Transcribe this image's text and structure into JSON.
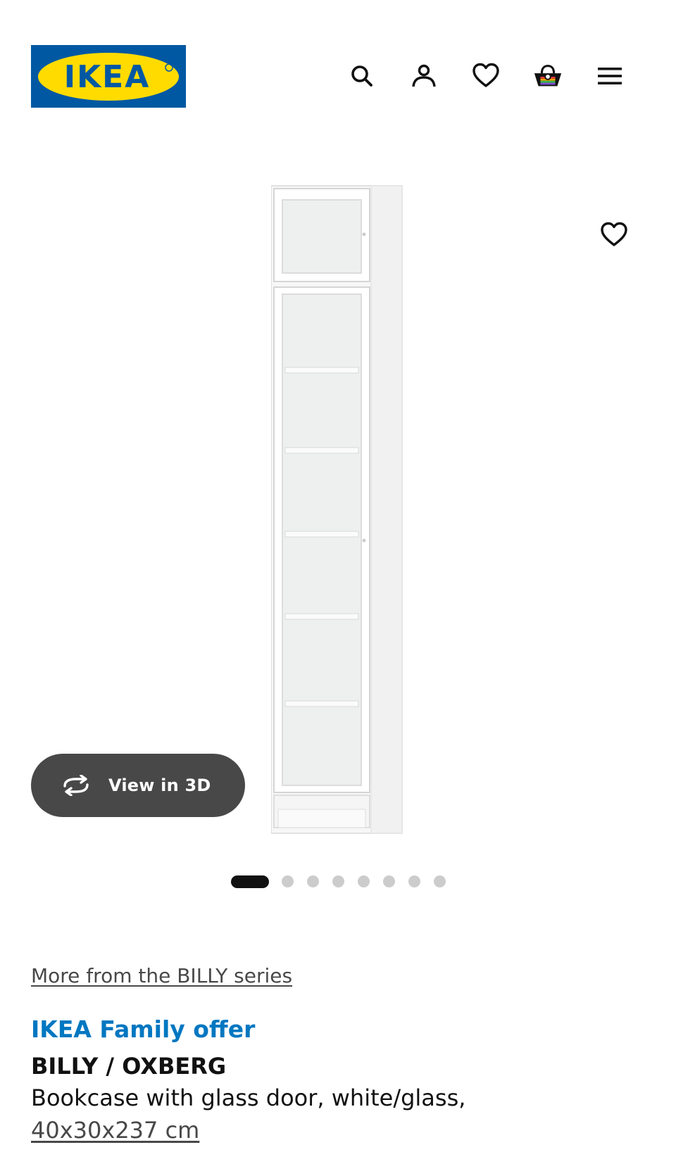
{
  "header": {
    "logo_text": "IKEA",
    "icons": [
      "search-icon",
      "account-icon",
      "heart-icon",
      "basket-icon",
      "menu-icon"
    ]
  },
  "gallery": {
    "view3d_label": "View in 3D",
    "slide_count": 8,
    "active_slide": 1
  },
  "product": {
    "series_link": "More from the BILLY series",
    "offer": "IKEA Family offer",
    "name": "BILLY / OXBERG",
    "description": "Bookcase with glass door, white/glass,",
    "dimensions": "40x30x237 cm"
  },
  "colors": {
    "brand_blue": "#0058a3",
    "brand_yellow": "#ffdb00",
    "offer_blue": "#0077c1",
    "button_dark": "#484848"
  }
}
